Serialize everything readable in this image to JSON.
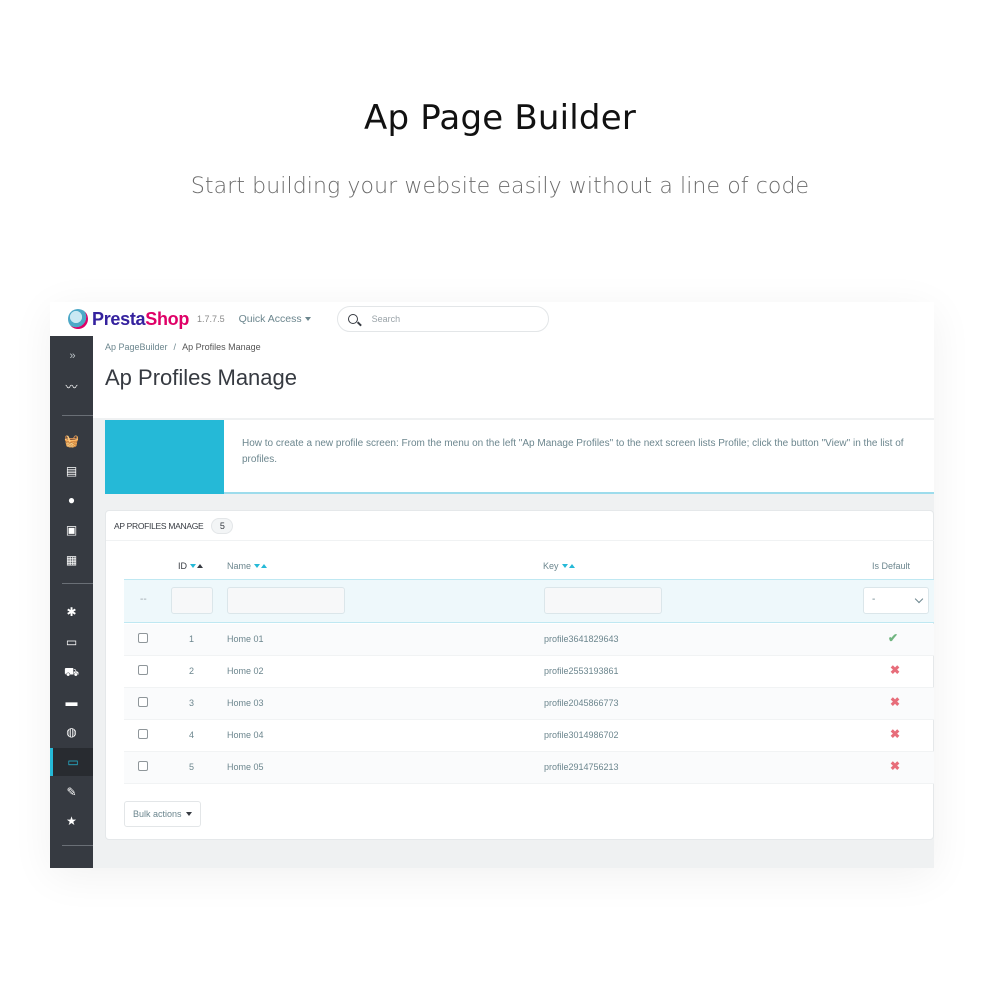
{
  "hero": {
    "title": "Ap Page Builder",
    "subtitle": "Start building your website easily without a line of code"
  },
  "topbar": {
    "logo_part1": "Presta",
    "logo_part2": "Shop",
    "version": "1.7.7.5",
    "quick_access": "Quick Access",
    "search_placeholder": "Search"
  },
  "sidebar": {
    "items": [
      {
        "icon": "expand-icon",
        "glyph": "»"
      },
      {
        "icon": "stats-icon",
        "glyph": "〰"
      },
      {
        "icon": "basket-icon",
        "glyph": "🧺"
      },
      {
        "icon": "store-icon",
        "glyph": "▤"
      },
      {
        "icon": "customer-icon",
        "glyph": "●"
      },
      {
        "icon": "messages-icon",
        "glyph": "▣"
      },
      {
        "icon": "reports-icon",
        "glyph": "▦"
      },
      {
        "icon": "modules-icon",
        "glyph": "✱"
      },
      {
        "icon": "design-icon",
        "glyph": "▭"
      },
      {
        "icon": "shipping-icon",
        "glyph": "⛟"
      },
      {
        "icon": "payment-icon",
        "glyph": "▬"
      },
      {
        "icon": "international-icon",
        "glyph": "◍"
      },
      {
        "icon": "folder-icon",
        "glyph": "▭",
        "active": true
      },
      {
        "icon": "edit-icon",
        "glyph": "✎"
      },
      {
        "icon": "star-icon",
        "glyph": "★"
      }
    ]
  },
  "breadcrumb": {
    "parent": "Ap PageBuilder",
    "separator": "/",
    "current": "Ap Profiles Manage"
  },
  "page_title": "Ap Profiles Manage",
  "alert": {
    "text": "How to create a new profile screen: From the menu on the left \"Ap Manage Profiles\" to the next screen lists Profile; click the button \"View\" in the list of profiles."
  },
  "panel": {
    "title": "Ap Profiles Manage",
    "count_badge": "5",
    "columns": {
      "id": "ID",
      "name": "Name",
      "key": "Key",
      "is_default": "Is Default"
    },
    "filter": {
      "dash": "--",
      "is_default_selected": "-"
    },
    "rows": [
      {
        "id": "1",
        "name": "Home 01",
        "key": "profile3641829643",
        "is_default": true
      },
      {
        "id": "2",
        "name": "Home 02",
        "key": "profile2553193861",
        "is_default": false
      },
      {
        "id": "3",
        "name": "Home 03",
        "key": "profile2045866773",
        "is_default": false
      },
      {
        "id": "4",
        "name": "Home 04",
        "key": "profile3014986702",
        "is_default": false
      },
      {
        "id": "5",
        "name": "Home 05",
        "key": "profile2914756213",
        "is_default": false
      }
    ],
    "bulk_actions": "Bulk actions"
  },
  "colors": {
    "accent": "#25b9d7",
    "sidebar_bg": "#363a41",
    "yes": "#70b580",
    "no": "#e76d7a",
    "brand_purple": "#34219e",
    "brand_pink": "#df0067"
  }
}
